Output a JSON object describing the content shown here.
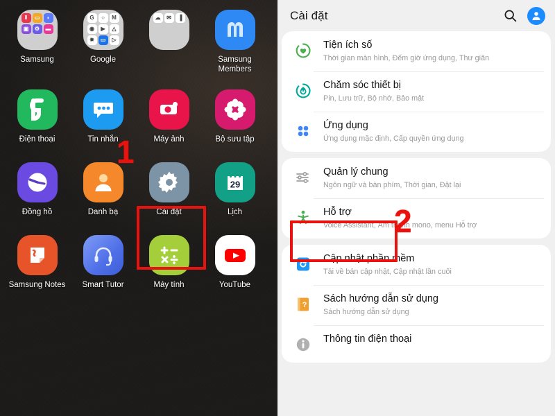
{
  "home": {
    "rows": [
      [
        {
          "label": "Samsung",
          "icon": "samsung-folder",
          "type": "folder",
          "mini": [
            {
              "bg": "#e8384f",
              "glyph": "‖"
            },
            {
              "bg": "#f5a623",
              "glyph": "▭"
            },
            {
              "bg": "#5b7cfa",
              "glyph": "◗"
            },
            {
              "bg": "#8b4fe0",
              "glyph": "▣"
            },
            {
              "bg": "#6c5ce7",
              "glyph": "⚙"
            },
            {
              "bg": "#e8399b",
              "glyph": "▬"
            }
          ]
        },
        {
          "label": "Google",
          "icon": "google-folder",
          "type": "folder",
          "mini": [
            {
              "bg": "#ffffff",
              "glyph": "G"
            },
            {
              "bg": "#ffffff",
              "glyph": "○"
            },
            {
              "bg": "#ffffff",
              "glyph": "M"
            },
            {
              "bg": "#ffffff",
              "glyph": "◉"
            },
            {
              "bg": "#ffffff",
              "glyph": "▶"
            },
            {
              "bg": "#ffffff",
              "glyph": "△"
            },
            {
              "bg": "#ffffff",
              "glyph": "✸"
            },
            {
              "bg": "#1a73e8",
              "glyph": "▭"
            },
            {
              "bg": "#ffffff",
              "glyph": "▷"
            }
          ]
        },
        {
          "label": "",
          "icon": "microsoft-folder",
          "type": "folder",
          "mini": [
            {
              "bg": "#ffffff",
              "glyph": "☁"
            },
            {
              "bg": "#ffffff",
              "glyph": "✉"
            },
            {
              "bg": "#ffffff",
              "glyph": "▐"
            }
          ]
        },
        {
          "label": "Samsung Members",
          "icon": "samsung-members-icon",
          "type": "app"
        }
      ],
      [
        {
          "label": "Điện thoại",
          "icon": "phone-icon",
          "type": "app"
        },
        {
          "label": "Tin nhắn",
          "icon": "messages-icon",
          "type": "app"
        },
        {
          "label": "Máy ảnh",
          "icon": "camera-icon",
          "type": "app"
        },
        {
          "label": "Bộ sưu tập",
          "icon": "gallery-icon",
          "type": "app"
        }
      ],
      [
        {
          "label": "Đồng hồ",
          "icon": "clock-icon",
          "type": "app"
        },
        {
          "label": "Danh bạ",
          "icon": "contacts-icon",
          "type": "app"
        },
        {
          "label": "Cài đặt",
          "icon": "settings-gear-icon",
          "type": "app"
        },
        {
          "label": "Lịch",
          "icon": "calendar-icon",
          "type": "app",
          "day": "29"
        }
      ],
      [
        {
          "label": "Samsung Notes",
          "icon": "samsung-notes-icon",
          "type": "app"
        },
        {
          "label": "Smart Tutor",
          "icon": "smart-tutor-icon",
          "type": "app"
        },
        {
          "label": "Máy tính",
          "icon": "calculator-icon",
          "type": "app"
        },
        {
          "label": "YouTube",
          "icon": "youtube-icon",
          "type": "app"
        }
      ]
    ]
  },
  "settings": {
    "title": "Cài đặt",
    "search_icon": "search-icon",
    "avatar_icon": "account-avatar-icon",
    "groups": [
      {
        "items": [
          {
            "title": "Tiện ích số",
            "sub": "Thời gian màn hình, Đếm giờ ứng dụng, Thư giãn",
            "icon": "digital-wellbeing-icon",
            "color": "#4caf50"
          },
          {
            "title": "Chăm sóc thiết bị",
            "sub": "Pin, Lưu trữ, Bộ nhớ, Bảo mật",
            "icon": "device-care-icon",
            "color": "#00a99d"
          },
          {
            "title": "Ứng dụng",
            "sub": "Ứng dụng mặc định, Cấp quyền ứng dụng",
            "icon": "apps-icon",
            "color": "#4285f4"
          }
        ]
      },
      {
        "items": [
          {
            "title": "Quản lý chung",
            "sub": "Ngôn ngữ và bàn phím, Thời gian, Đặt lại",
            "icon": "general-management-icon",
            "color": "#9e9e9e"
          },
          {
            "title": "Hỗ trợ",
            "sub": "Voice Assistant, Âm thanh mono, menu Hỗ trợ",
            "icon": "accessibility-icon",
            "color": "#4caf50"
          }
        ]
      },
      {
        "items": [
          {
            "title": "Cập nhật phần mềm",
            "sub": "Tải về bản cập nhật, Cập nhật lần cuối",
            "icon": "software-update-icon",
            "color": "#2196f3"
          },
          {
            "title": "Sách hướng dẫn sử dụng",
            "sub": "Sách hướng dẫn sử dụng",
            "icon": "user-manual-icon",
            "color": "#f0a030"
          },
          {
            "title": "Thông tin điện thoại",
            "sub": "",
            "icon": "phone-info-icon",
            "color": "#9e9e9e"
          }
        ]
      }
    ]
  },
  "annotations": {
    "step_one": "1",
    "step_two": "2",
    "highlight_color": "#e8130e"
  }
}
